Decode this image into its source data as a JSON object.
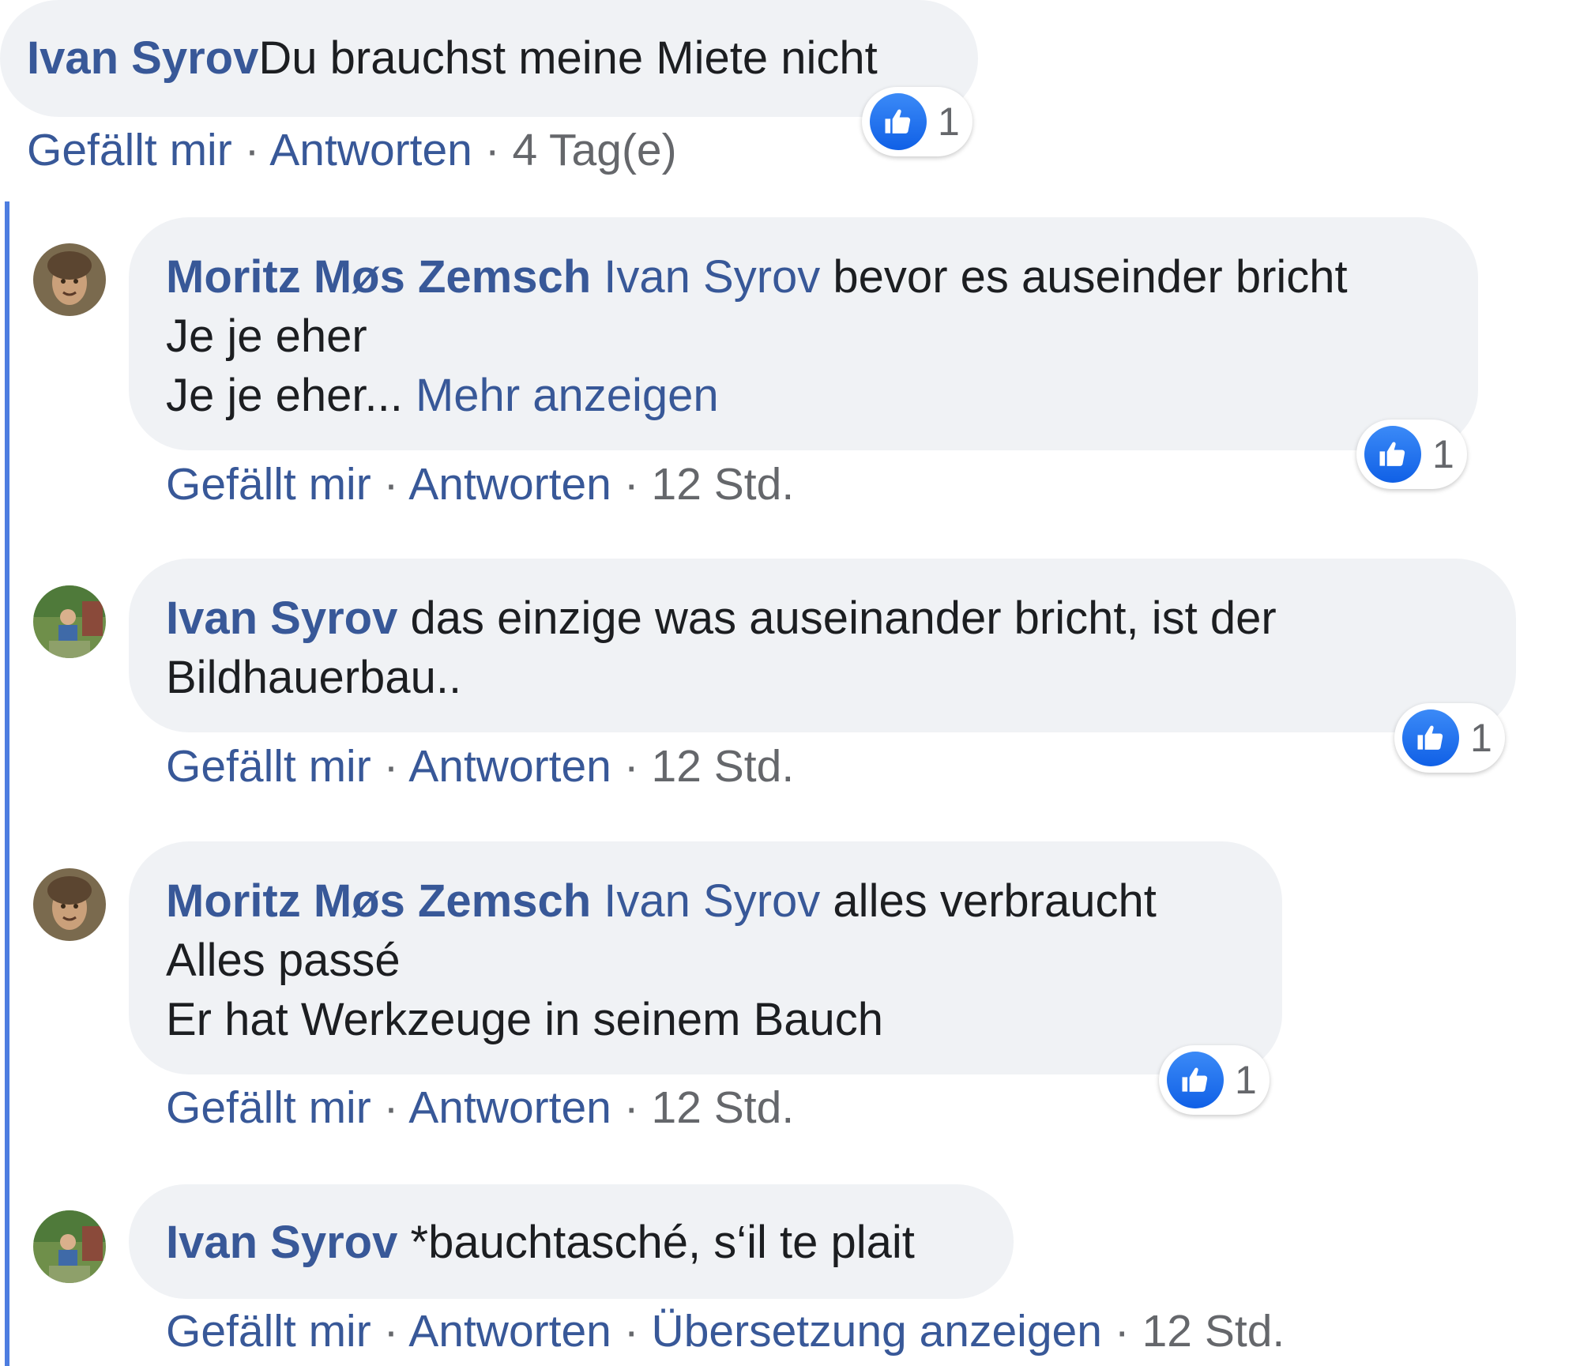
{
  "colors": {
    "link_blue": "#385898",
    "bubble_bg": "#f0f2f5",
    "like_blue": "#1877f2",
    "thread_line": "#4d7de0"
  },
  "comments": [
    {
      "author": "Ivan Syrov",
      "lines": [
        "Du brauchst meine Miete nicht"
      ],
      "like_label": "Gefällt mir",
      "reply_label": "Antworten",
      "time": "4 Tag(e)",
      "reaction_icon": "thumbs-up-icon",
      "reaction_count": "1"
    }
  ],
  "replies": [
    {
      "author": "Moritz Møs Zemsch",
      "avatar": "painting-portrait-avatar",
      "mention": "Ivan Syrov",
      "lines": [
        "bevor es auseinder bricht",
        "Je je eher",
        "Je je eher..."
      ],
      "more_label": "Mehr anzeigen",
      "like_label": "Gefällt mir",
      "reply_label": "Antworten",
      "time": "12 Std.",
      "reaction_icon": "thumbs-up-icon",
      "reaction_count": "1"
    },
    {
      "author": "Ivan Syrov",
      "avatar": "outdoor-photo-avatar",
      "lines": [
        "das einzige was auseinander bricht, ist der",
        "Bildhauerbau.."
      ],
      "like_label": "Gefällt mir",
      "reply_label": "Antworten",
      "time": "12 Std.",
      "reaction_icon": "thumbs-up-icon",
      "reaction_count": "1"
    },
    {
      "author": "Moritz Møs Zemsch",
      "avatar": "painting-portrait-avatar",
      "mention": "Ivan Syrov",
      "lines": [
        "alles verbraucht",
        "Alles passé",
        "Er hat Werkzeuge in seinem Bauch"
      ],
      "like_label": "Gefällt mir",
      "reply_label": "Antworten",
      "time": "12 Std.",
      "reaction_icon": "thumbs-up-icon",
      "reaction_count": "1"
    },
    {
      "author": "Ivan Syrov",
      "avatar": "outdoor-photo-avatar",
      "lines": [
        "*bauchtasché, s‘il te plait"
      ],
      "like_label": "Gefällt mir",
      "reply_label": "Antworten",
      "translate_label": "Übersetzung anzeigen",
      "time": "12 Std."
    }
  ],
  "separator": "·"
}
